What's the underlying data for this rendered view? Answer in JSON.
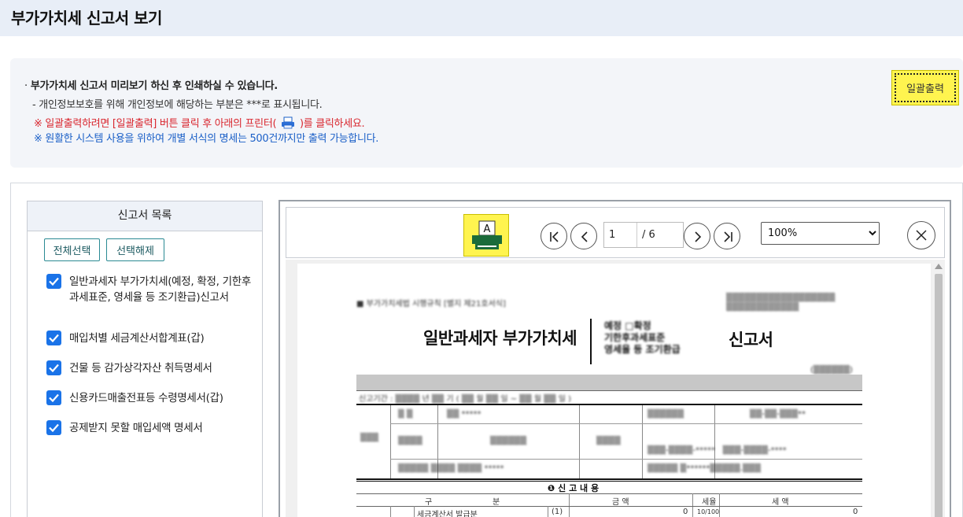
{
  "page": {
    "title": "부가가치세 신고서 보기"
  },
  "notice": {
    "line1": "부가가치세 신고서 미리보기 하신 후 인쇄하실 수 있습니다.",
    "line2": "- 개인정보보호를 위해 개인정보에 해당하는 부분은  ***로 표시됩니다.",
    "line3_before": "※ 일괄출력하려면 [일괄출력] 버튼 클릭 후 아래의 프린터(",
    "line3_after": ")를 클릭하세요.",
    "line4": "※ 원활한 시스템 사용을 위하여 개별 서식의 명세는 500건까지만 출력 가능합니다.",
    "bulk_print_label": "일괄출력"
  },
  "colors": {
    "yellow_highlight": "#fff44f",
    "notice_red": "#d9262e",
    "notice_blue": "#1a5fc7",
    "checkbox_blue": "#1a73e8",
    "title_bar_bg": "#e8eef7"
  },
  "report_list": {
    "header": "신고서 목록",
    "select_all": "전체선택",
    "deselect": "선택해제",
    "items": [
      {
        "label": "일반과세자 부가가치세(예정, 확정, 기한후과세표준, 영세율 등 조기환급)신고서",
        "checked": true
      },
      {
        "label": "매입처별 세금계산서합계표(갑)",
        "checked": true
      },
      {
        "label": "건물 등 감가상각자산 취득명세서",
        "checked": true
      },
      {
        "label": "신용카드매출전표등 수령명세서(갑)",
        "checked": true
      },
      {
        "label": "공제받지 못할 매입세액 명세서",
        "checked": true
      }
    ]
  },
  "viewer": {
    "print_icon": "printer-icon",
    "page_current": "1",
    "page_total": "/ 6",
    "zoom": "100%",
    "zoom_options": [
      "100%"
    ]
  },
  "document": {
    "title_left": "일반과세자 부가가치세",
    "title_mid_lines": [
      "예정   □확정",
      "기한후과세표준",
      "영세율 등 조기환급"
    ],
    "title_right": "신고서",
    "header_note": "■ 부가가치세법 시행규칙 [별지 제21호서식]",
    "section_title": "❶ 신    고    내    용",
    "col_headers": [
      "구",
      "분",
      "금     액",
      "세율",
      "세     액"
    ],
    "row1_label": "세금계산서 발급분",
    "row1_code": "(1)",
    "row1_amount": "0",
    "row1_rate": "10/100",
    "row1_tax": "0"
  }
}
